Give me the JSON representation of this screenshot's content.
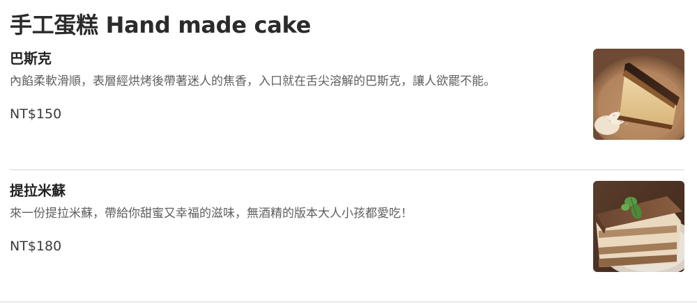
{
  "section": {
    "title": "手工蛋糕 Hand made cake"
  },
  "items": [
    {
      "name": "巴斯克",
      "description": "內餡柔軟滑順，表層經烘烤後帶著迷人的焦香，入口就在舌尖溶解的巴斯克，讓人欲罷不能。",
      "price": "NT$150",
      "photo_icon": "basque-cheesecake-photo"
    },
    {
      "name": "提拉米蘇",
      "description": "來一份提拉米蘇，帶給你甜蜜又幸福的滋味，無酒精的版本大人小孩都愛吃！",
      "price": "NT$180",
      "photo_icon": "tiramisu-photo"
    }
  ],
  "colors": {
    "text_primary": "#222222",
    "text_secondary": "#5e5e5e",
    "divider": "#e8e8e8"
  }
}
